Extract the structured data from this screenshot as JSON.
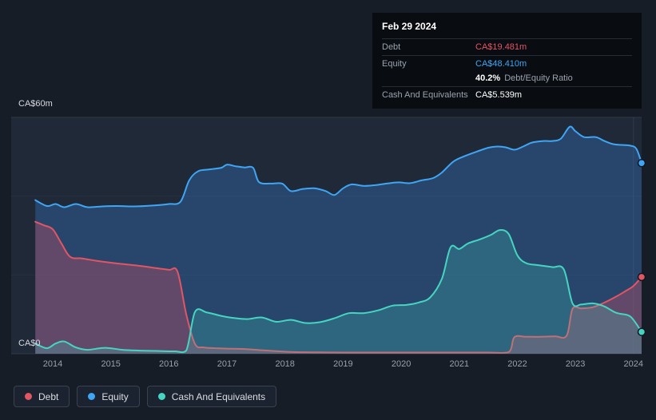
{
  "colors": {
    "debt": "#e25563",
    "equity": "#3ea6f5",
    "cash": "#45d6c2",
    "background": "#171d27",
    "plot_background": "#202938"
  },
  "tooltip": {
    "date": "Feb 29 2024",
    "debt_label": "Debt",
    "debt_value": "CA$19.481m",
    "equity_label": "Equity",
    "equity_value": "CA$48.410m",
    "ratio_value": "40.2%",
    "ratio_label": "Debt/Equity Ratio",
    "cash_label": "Cash And Equivalents",
    "cash_value": "CA$5.539m"
  },
  "axis": {
    "y_top_label": "CA$60m",
    "y_bottom_label": "CA$0"
  },
  "legend": {
    "items": [
      {
        "label": "Debt",
        "color": "#e25563"
      },
      {
        "label": "Equity",
        "color": "#3ea6f5"
      },
      {
        "label": "Cash And Equivalents",
        "color": "#45d6c2"
      }
    ]
  },
  "chart_data": {
    "type": "area",
    "y_unit": "CA$m",
    "ylim": [
      0,
      60
    ],
    "x_range": [
      2013.285,
      2024.14
    ],
    "gridlines": [
      0,
      20,
      40,
      60
    ],
    "x_ticks": [
      2014,
      2015,
      2016,
      2017,
      2018,
      2019,
      2020,
      2021,
      2022,
      2023,
      2024
    ],
    "today_line_x": 2024,
    "legend_position": "bottom-left",
    "series": [
      {
        "name": "Equity",
        "color": "#3ea6f5",
        "fill": "rgba(58,140,228,0.30)",
        "points": [
          [
            2013.7,
            39
          ],
          [
            2013.9,
            37.5
          ],
          [
            2014.05,
            38
          ],
          [
            2014.2,
            37.2
          ],
          [
            2014.4,
            38
          ],
          [
            2014.6,
            37.2
          ],
          [
            2014.85,
            37.4
          ],
          [
            2015.1,
            37.5
          ],
          [
            2015.4,
            37.4
          ],
          [
            2015.7,
            37.6
          ],
          [
            2016.0,
            38
          ],
          [
            2016.2,
            38.6
          ],
          [
            2016.35,
            44
          ],
          [
            2016.5,
            46.3
          ],
          [
            2016.7,
            46.8
          ],
          [
            2016.9,
            47.2
          ],
          [
            2017.0,
            48
          ],
          [
            2017.15,
            47.6
          ],
          [
            2017.3,
            47.3
          ],
          [
            2017.45,
            47.2
          ],
          [
            2017.55,
            43.6
          ],
          [
            2017.75,
            43.2
          ],
          [
            2017.95,
            43.2
          ],
          [
            2018.1,
            41.3
          ],
          [
            2018.3,
            41.8
          ],
          [
            2018.5,
            42
          ],
          [
            2018.7,
            41.3
          ],
          [
            2018.85,
            40.3
          ],
          [
            2019.0,
            42
          ],
          [
            2019.15,
            43
          ],
          [
            2019.35,
            42.6
          ],
          [
            2019.55,
            42.8
          ],
          [
            2019.75,
            43.2
          ],
          [
            2019.95,
            43.5
          ],
          [
            2020.15,
            43.3
          ],
          [
            2020.35,
            44
          ],
          [
            2020.55,
            44.6
          ],
          [
            2020.7,
            46
          ],
          [
            2020.9,
            48.8
          ],
          [
            2021.1,
            50.2
          ],
          [
            2021.3,
            51.3
          ],
          [
            2021.5,
            52.3
          ],
          [
            2021.65,
            52.6
          ],
          [
            2021.8,
            52.4
          ],
          [
            2021.95,
            51.8
          ],
          [
            2022.1,
            52.6
          ],
          [
            2022.25,
            53.6
          ],
          [
            2022.45,
            54
          ],
          [
            2022.6,
            54
          ],
          [
            2022.75,
            54.6
          ],
          [
            2022.9,
            57.6
          ],
          [
            2023.0,
            56.5
          ],
          [
            2023.15,
            55
          ],
          [
            2023.35,
            55
          ],
          [
            2023.5,
            54
          ],
          [
            2023.65,
            53.2
          ],
          [
            2023.8,
            53
          ],
          [
            2023.95,
            52.8
          ],
          [
            2024.05,
            52
          ],
          [
            2024.14,
            48.41
          ]
        ]
      },
      {
        "name": "Debt",
        "color": "#e25563",
        "fill": "rgba(222,80,100,0.32)",
        "points": [
          [
            2013.7,
            33.5
          ],
          [
            2013.85,
            32.6
          ],
          [
            2014.0,
            31.6
          ],
          [
            2014.15,
            28
          ],
          [
            2014.3,
            24.6
          ],
          [
            2014.5,
            24.2
          ],
          [
            2014.75,
            23.6
          ],
          [
            2015.0,
            23.1
          ],
          [
            2015.25,
            22.7
          ],
          [
            2015.5,
            22.3
          ],
          [
            2015.75,
            21.8
          ],
          [
            2016.0,
            21.3
          ],
          [
            2016.15,
            20.8
          ],
          [
            2016.3,
            10
          ],
          [
            2016.45,
            2.5
          ],
          [
            2016.6,
            1.6
          ],
          [
            2016.8,
            1.4
          ],
          [
            2017.0,
            1.3
          ],
          [
            2017.3,
            1.2
          ],
          [
            2017.6,
            0.9
          ],
          [
            2017.9,
            0.6
          ],
          [
            2018.2,
            0.4
          ],
          [
            2018.6,
            0.35
          ],
          [
            2019.0,
            0.3
          ],
          [
            2019.5,
            0.3
          ],
          [
            2020.0,
            0.3
          ],
          [
            2020.5,
            0.3
          ],
          [
            2021.0,
            0.3
          ],
          [
            2021.5,
            0.3
          ],
          [
            2021.85,
            0.4
          ],
          [
            2021.95,
            4.2
          ],
          [
            2022.15,
            4.3
          ],
          [
            2022.4,
            4.3
          ],
          [
            2022.65,
            4.4
          ],
          [
            2022.85,
            4.6
          ],
          [
            2022.95,
            11.4
          ],
          [
            2023.1,
            11.5
          ],
          [
            2023.3,
            11.8
          ],
          [
            2023.5,
            13
          ],
          [
            2023.7,
            14.5
          ],
          [
            2023.85,
            15.8
          ],
          [
            2024.0,
            17.2
          ],
          [
            2024.14,
            19.481
          ]
        ]
      },
      {
        "name": "Cash And Equivalents",
        "color": "#45d6c2",
        "fill": "rgba(69,214,194,0.22)",
        "points": [
          [
            2013.7,
            2.6
          ],
          [
            2013.9,
            1.4
          ],
          [
            2014.05,
            2.6
          ],
          [
            2014.2,
            3.1
          ],
          [
            2014.4,
            1.6
          ],
          [
            2014.6,
            1.0
          ],
          [
            2014.9,
            1.5
          ],
          [
            2015.2,
            1.0
          ],
          [
            2015.5,
            0.8
          ],
          [
            2015.8,
            0.7
          ],
          [
            2016.1,
            0.6
          ],
          [
            2016.3,
            0.8
          ],
          [
            2016.45,
            10.6
          ],
          [
            2016.65,
            10.5
          ],
          [
            2016.9,
            9.6
          ],
          [
            2017.1,
            9.1
          ],
          [
            2017.35,
            8.8
          ],
          [
            2017.6,
            9.2
          ],
          [
            2017.85,
            8.1
          ],
          [
            2018.1,
            8.6
          ],
          [
            2018.35,
            7.8
          ],
          [
            2018.6,
            8.0
          ],
          [
            2018.85,
            9.0
          ],
          [
            2019.1,
            10.3
          ],
          [
            2019.35,
            10.3
          ],
          [
            2019.6,
            11.0
          ],
          [
            2019.85,
            12.2
          ],
          [
            2020.1,
            12.4
          ],
          [
            2020.3,
            13.0
          ],
          [
            2020.5,
            14.3
          ],
          [
            2020.7,
            19.0
          ],
          [
            2020.85,
            27.0
          ],
          [
            2021.0,
            26.6
          ],
          [
            2021.15,
            28.0
          ],
          [
            2021.35,
            29.0
          ],
          [
            2021.55,
            30.2
          ],
          [
            2021.7,
            31.4
          ],
          [
            2021.85,
            30.4
          ],
          [
            2022.0,
            25.0
          ],
          [
            2022.15,
            23.0
          ],
          [
            2022.35,
            22.5
          ],
          [
            2022.6,
            22.0
          ],
          [
            2022.8,
            21.4
          ],
          [
            2022.95,
            12.8
          ],
          [
            2023.1,
            12.5
          ],
          [
            2023.3,
            12.8
          ],
          [
            2023.5,
            12.0
          ],
          [
            2023.7,
            10.4
          ],
          [
            2023.9,
            9.8
          ],
          [
            2024.0,
            8.6
          ],
          [
            2024.14,
            5.539
          ]
        ]
      }
    ]
  }
}
